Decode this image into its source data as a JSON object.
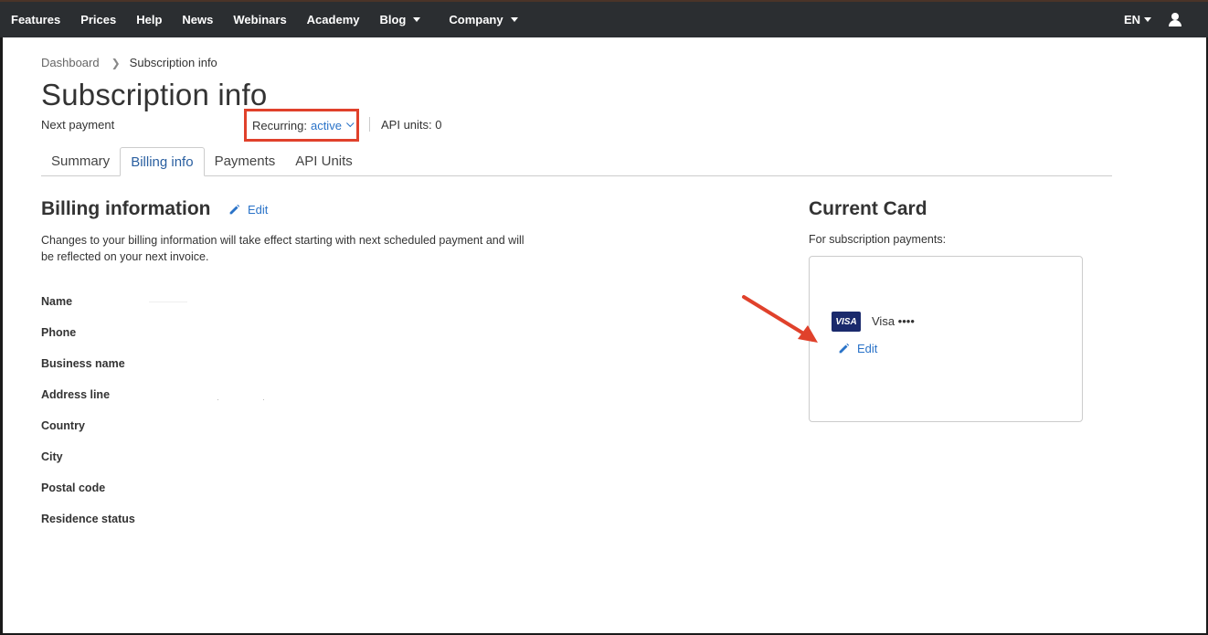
{
  "nav": {
    "items": [
      "Features",
      "Prices",
      "Help",
      "News",
      "Webinars",
      "Academy"
    ],
    "dropdowns": [
      "Blog",
      "Company"
    ],
    "lang": "EN"
  },
  "breadcrumb": {
    "root": "Dashboard",
    "current": "Subscription info"
  },
  "page": {
    "title": "Subscription info",
    "next_payment": "Next payment",
    "recurring_label": "Recurring:",
    "recurring_value": "active",
    "api_units": "API units: 0"
  },
  "tabs": [
    "Summary",
    "Billing info",
    "Payments",
    "API Units"
  ],
  "active_tab": "Billing info",
  "billing": {
    "heading": "Billing information",
    "edit": "Edit",
    "description": "Changes to your billing information will take effect starting with next scheduled payment and will be reflected on your next invoice.",
    "fields": [
      "Name",
      "Phone",
      "Business name",
      "Address line",
      "Country",
      "City",
      "Postal code",
      "Residence status"
    ]
  },
  "card": {
    "heading": "Current Card",
    "subheading": "For subscription payments:",
    "brand_logo": "VISA",
    "label": "Visa ••••",
    "edit": "Edit"
  },
  "colors": {
    "nav_bg": "#2b2e31",
    "link": "#2a73c8",
    "highlight_box": "#e0412b",
    "visa_blue": "#1a2a6c"
  }
}
